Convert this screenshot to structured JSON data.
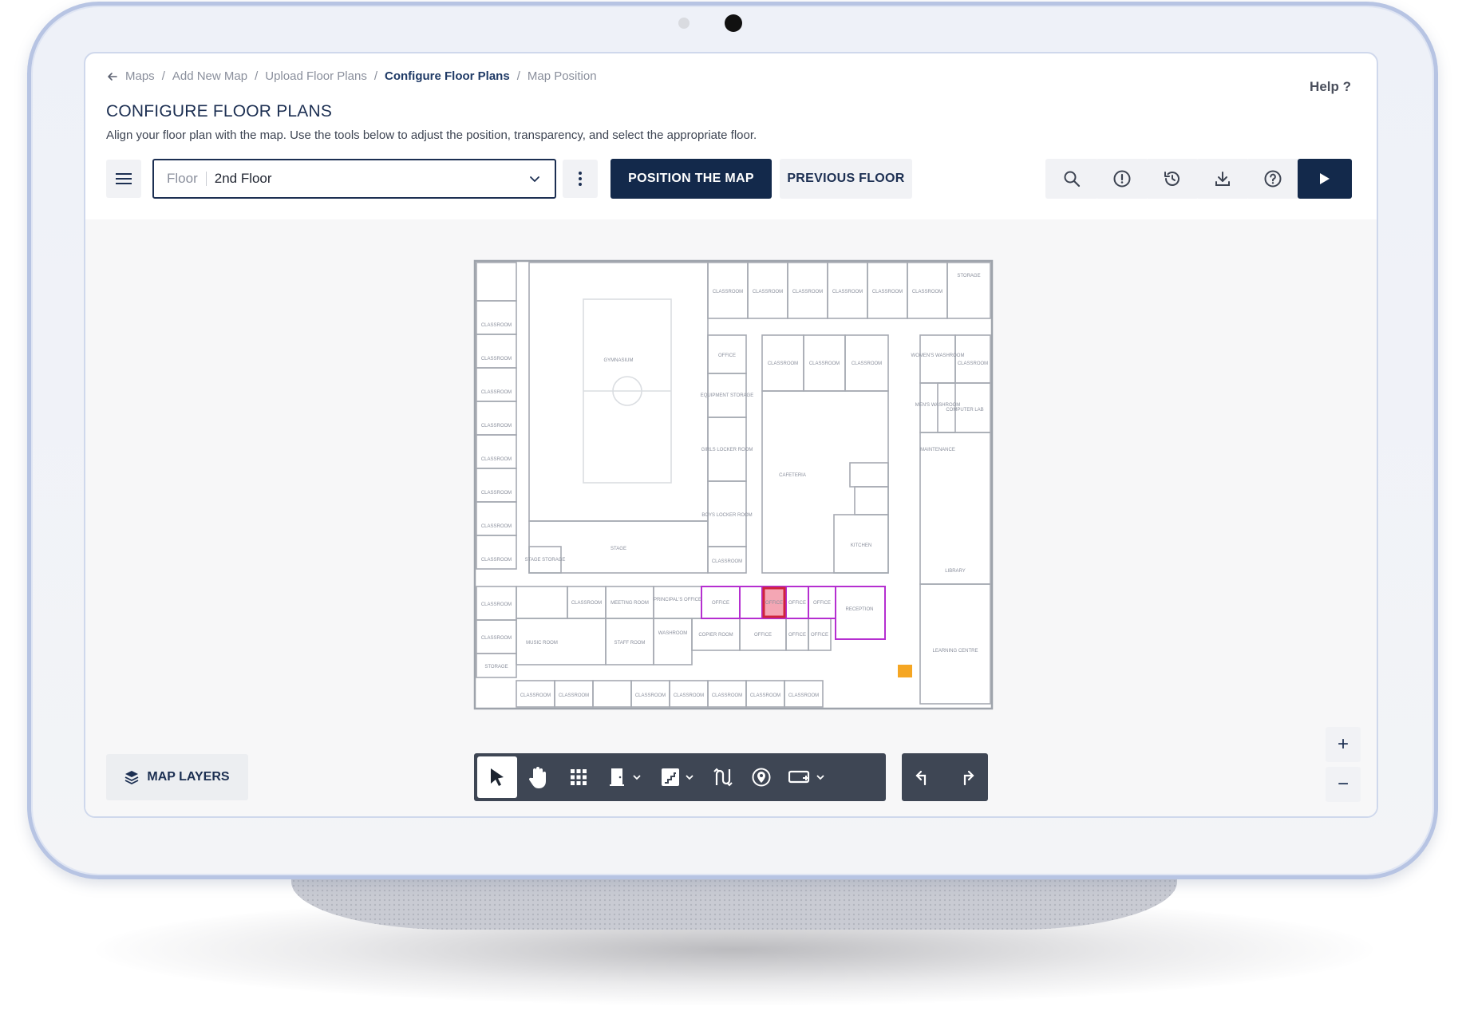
{
  "breadcrumb": {
    "items": [
      {
        "label": "Maps"
      },
      {
        "label": "Add New Map"
      },
      {
        "label": "Upload Floor Plans"
      },
      {
        "label": "Configure Floor Plans"
      },
      {
        "label": "Map Position"
      }
    ],
    "separator": "/"
  },
  "help": {
    "label": "Help ?"
  },
  "page": {
    "title": "CONFIGURE FLOOR PLANS",
    "description": "Align your floor plan with the map. Use the tools below to adjust the position, transparency, and select the appropriate floor."
  },
  "toolbar": {
    "floor_label": "Floor",
    "floor_value": "2nd Floor",
    "position_button": "POSITION THE MAP",
    "previous_button": "PREVIOUS FLOOR"
  },
  "canvas": {
    "map_layers_label": "MAP LAYERS",
    "zoom_in": "+",
    "zoom_out": "−"
  },
  "floorplan_labels": {
    "storage": "STORAGE",
    "classroom": "CLASSROOM",
    "gymnasium": "GYMNASIUM",
    "office": "OFFICE",
    "equipment": "EQUIPMENT STORAGE",
    "girls_locker": "GIRLS LOCKER ROOM",
    "boys_locker": "BOYS LOCKER ROOM",
    "cafeteria": "CAFETERIA",
    "stage": "STAGE",
    "stage_storage": "STAGE STORAGE",
    "kitchen": "KITCHEN",
    "womens": "WOMEN'S WASHROOM",
    "mens": "MEN'S WASHROOM",
    "maintenance": "MAINTENANCE",
    "computer_lab": "COMPUTER LAB",
    "library": "LIBRARY",
    "meeting": "MEETING ROOM",
    "principal": "PRINCIPAL'S OFFICE",
    "reception": "RECEPTION",
    "music": "MUSIC ROOM",
    "staff": "STAFF ROOM",
    "copier": "COPIER ROOM",
    "washroom": "WASHROOM",
    "learning": "LEARNING CENTRE"
  },
  "colors": {
    "primary": "#13294b",
    "highlight_fill": "#f4a6b4",
    "highlight_border": "#d0243c",
    "selection_border": "#b52fd0",
    "marker": "#f5a623"
  }
}
